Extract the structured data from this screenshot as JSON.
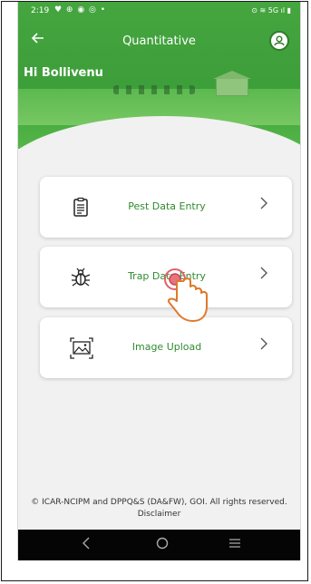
{
  "status_bar": {
    "time": "2:19",
    "left_icons": "♥ ⊕ ◉ ◎ •",
    "right_icons": "⊙ ≋ 5G ıl ▮"
  },
  "app_bar": {
    "title": "Quantitative",
    "back_icon": "arrow-left-icon",
    "profile_icon": "user-circle-icon"
  },
  "greeting": "Hi Bollivenu",
  "cards": [
    {
      "label": "Pest Data Entry",
      "icon": "document-icon"
    },
    {
      "label": "Trap Data Entry",
      "icon": "bug-icon"
    },
    {
      "label": "Image Upload",
      "icon": "image-icon"
    }
  ],
  "footer": {
    "copyright": "© ICAR-NCIPM and DPPQ&S (DA&FW), GOI. All rights reserved.",
    "disclaimer": "Disclaimer"
  },
  "colors": {
    "brand_green": "#3f9f3b",
    "label_green": "#2e8b2e",
    "nav_bar": "#050505"
  }
}
